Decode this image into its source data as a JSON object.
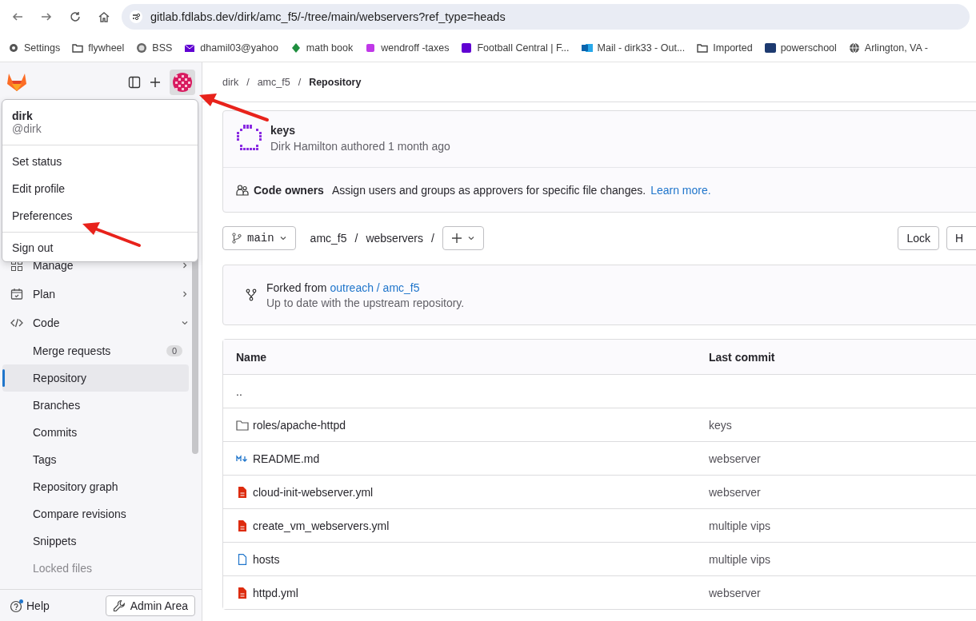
{
  "browser": {
    "url": "gitlab.fdlabs.dev/dirk/amc_f5/-/tree/main/webservers?ref_type=heads",
    "bookmarks": [
      {
        "label": "Settings",
        "kind": "gear"
      },
      {
        "label": "flywheel",
        "kind": "folder"
      },
      {
        "label": "BSS",
        "kind": "seal"
      },
      {
        "label": "dhamil03@yahoo",
        "kind": "mail"
      },
      {
        "label": "math book",
        "kind": "diamond"
      },
      {
        "label": "wendroff -taxes",
        "kind": "app"
      },
      {
        "label": "Football Central | F...",
        "kind": "yahoo"
      },
      {
        "label": "Mail - dirk33 - Out...",
        "kind": "outlook"
      },
      {
        "label": "Imported",
        "kind": "folder"
      },
      {
        "label": "powerschool",
        "kind": "school"
      },
      {
        "label": "Arlington, VA -",
        "kind": "globe"
      }
    ]
  },
  "sidebar": {
    "user_menu": {
      "name": "dirk",
      "handle": "@dirk",
      "groups": [
        [
          "Set status",
          "Edit profile",
          "Preferences"
        ],
        [
          "Sign out"
        ]
      ]
    },
    "items": [
      {
        "kind": "section",
        "label": "Manage",
        "expanded": false
      },
      {
        "kind": "section",
        "label": "Plan",
        "expanded": false
      },
      {
        "kind": "section",
        "label": "Code",
        "expanded": true,
        "children": [
          {
            "label": "Merge requests",
            "count": "0",
            "selected": false,
            "disabled": false
          },
          {
            "label": "Repository",
            "selected": true,
            "disabled": false
          },
          {
            "label": "Branches",
            "selected": false,
            "disabled": false
          },
          {
            "label": "Commits",
            "selected": false,
            "disabled": false
          },
          {
            "label": "Tags",
            "selected": false,
            "disabled": false
          },
          {
            "label": "Repository graph",
            "selected": false,
            "disabled": false
          },
          {
            "label": "Compare revisions",
            "selected": false,
            "disabled": false
          },
          {
            "label": "Snippets",
            "selected": false,
            "disabled": false
          },
          {
            "label": "Locked files",
            "selected": false,
            "disabled": true
          }
        ]
      }
    ],
    "help": "Help",
    "admin": "Admin Area"
  },
  "separator": "/",
  "breadcrumb": [
    "dirk",
    "amc_f5",
    "Repository"
  ],
  "commit": {
    "title": "keys",
    "meta": "Dirk Hamilton authored 1 month ago"
  },
  "code_owners": {
    "label": "Code owners",
    "text": "Assign users and groups as approvers for specific file changes.",
    "link": "Learn more."
  },
  "branch": "main",
  "path": [
    "amc_f5",
    "webservers"
  ],
  "buttons": [
    "Lock",
    "H"
  ],
  "fork": {
    "prefix": "Forked from",
    "link": "outreach / amc_f5",
    "status": "Up to date with the upstream repository."
  },
  "table": {
    "columns": [
      "Name",
      "Last commit"
    ],
    "rows": [
      {
        "kind": "parent",
        "name": ".."
      },
      {
        "kind": "folder",
        "name": "roles/apache-httpd",
        "commit": "keys"
      },
      {
        "kind": "markdown",
        "name": "README.md",
        "commit": "webserver"
      },
      {
        "kind": "yaml",
        "name": "cloud-init-webserver.yml",
        "commit": "webserver"
      },
      {
        "kind": "yaml",
        "name": "create_vm_webservers.yml",
        "commit": "multiple vips"
      },
      {
        "kind": "file",
        "name": "hosts",
        "commit": "multiple vips"
      },
      {
        "kind": "yaml",
        "name": "httpd.yml",
        "commit": "webserver"
      }
    ]
  }
}
